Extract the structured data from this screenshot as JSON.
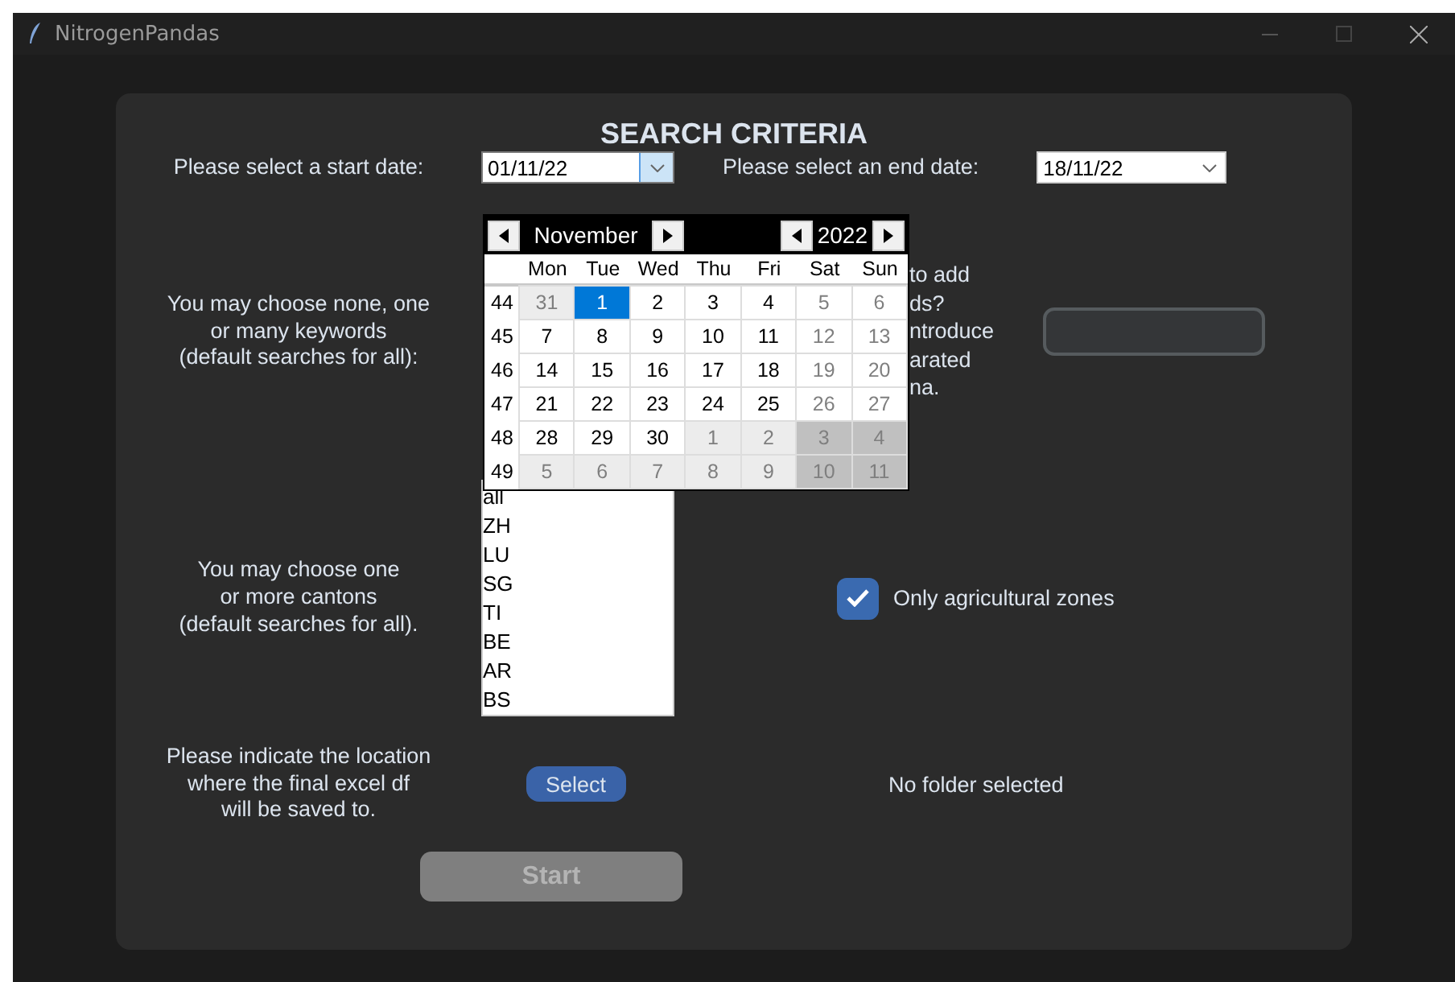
{
  "window": {
    "title": "NitrogenPandas"
  },
  "heading": "SEARCH CRITERIA",
  "start_date": {
    "label": "Please select a start date:",
    "value": "01/11/22",
    "open": true
  },
  "end_date": {
    "label": "Please select an end date:",
    "value": "18/11/22"
  },
  "calendar": {
    "month": "November",
    "year": "2022",
    "weekdays": [
      "Mon",
      "Tue",
      "Wed",
      "Thu",
      "Fri",
      "Sat",
      "Sun"
    ],
    "weeks": [
      {
        "number": "44",
        "days": [
          {
            "label": "31",
            "kind": "other",
            "selected": false
          },
          {
            "label": "1",
            "kind": "current",
            "selected": true
          },
          {
            "label": "2",
            "kind": "current",
            "selected": false
          },
          {
            "label": "3",
            "kind": "current",
            "selected": false
          },
          {
            "label": "4",
            "kind": "current",
            "selected": false
          },
          {
            "label": "5",
            "kind": "current",
            "selected": false
          },
          {
            "label": "6",
            "kind": "current",
            "selected": false
          }
        ]
      },
      {
        "number": "45",
        "days": [
          {
            "label": "7",
            "kind": "current",
            "selected": false
          },
          {
            "label": "8",
            "kind": "current",
            "selected": false
          },
          {
            "label": "9",
            "kind": "current",
            "selected": false
          },
          {
            "label": "10",
            "kind": "current",
            "selected": false
          },
          {
            "label": "11",
            "kind": "current",
            "selected": false
          },
          {
            "label": "12",
            "kind": "current",
            "selected": false
          },
          {
            "label": "13",
            "kind": "current",
            "selected": false
          }
        ]
      },
      {
        "number": "46",
        "days": [
          {
            "label": "14",
            "kind": "current",
            "selected": false
          },
          {
            "label": "15",
            "kind": "current",
            "selected": false
          },
          {
            "label": "16",
            "kind": "current",
            "selected": false
          },
          {
            "label": "17",
            "kind": "current",
            "selected": false
          },
          {
            "label": "18",
            "kind": "current",
            "selected": false
          },
          {
            "label": "19",
            "kind": "current",
            "selected": false
          },
          {
            "label": "20",
            "kind": "current",
            "selected": false
          }
        ]
      },
      {
        "number": "47",
        "days": [
          {
            "label": "21",
            "kind": "current",
            "selected": false
          },
          {
            "label": "22",
            "kind": "current",
            "selected": false
          },
          {
            "label": "23",
            "kind": "current",
            "selected": false
          },
          {
            "label": "24",
            "kind": "current",
            "selected": false
          },
          {
            "label": "25",
            "kind": "current",
            "selected": false
          },
          {
            "label": "26",
            "kind": "current",
            "selected": false
          },
          {
            "label": "27",
            "kind": "current",
            "selected": false
          }
        ]
      },
      {
        "number": "48",
        "days": [
          {
            "label": "28",
            "kind": "current",
            "selected": false
          },
          {
            "label": "29",
            "kind": "current",
            "selected": false
          },
          {
            "label": "30",
            "kind": "current",
            "selected": false
          },
          {
            "label": "1",
            "kind": "other",
            "selected": false
          },
          {
            "label": "2",
            "kind": "other",
            "selected": false
          },
          {
            "label": "3",
            "kind": "other",
            "selected": false
          },
          {
            "label": "4",
            "kind": "other",
            "selected": false
          }
        ]
      },
      {
        "number": "49",
        "days": [
          {
            "label": "5",
            "kind": "other",
            "selected": false
          },
          {
            "label": "6",
            "kind": "other",
            "selected": false
          },
          {
            "label": "7",
            "kind": "other",
            "selected": false
          },
          {
            "label": "8",
            "kind": "other",
            "selected": false
          },
          {
            "label": "9",
            "kind": "other",
            "selected": false
          },
          {
            "label": "10",
            "kind": "other",
            "selected": false
          },
          {
            "label": "11",
            "kind": "other",
            "selected": false
          }
        ]
      }
    ]
  },
  "keywords": {
    "label": "You may choose none, one\nor many keywords\n (default searches for all):",
    "own_keywords_label_visible": [
      "to add",
      "ds?",
      "ntroduce",
      "arated",
      "na."
    ]
  },
  "cantons": {
    "label": "You may choose one\nor more cantons\n(default searches for all).",
    "items": [
      "all",
      "ZH",
      "LU",
      "SG",
      "TI",
      "BE",
      "AR",
      "BS"
    ]
  },
  "agricultural": {
    "label": "Only agricultural zones",
    "checked": true
  },
  "location": {
    "label": "Please indicate the location\nwhere the final excel df\nwill be saved to.",
    "button": "Select",
    "status": "No folder selected"
  },
  "start_button": {
    "label": "Start",
    "disabled": true
  }
}
